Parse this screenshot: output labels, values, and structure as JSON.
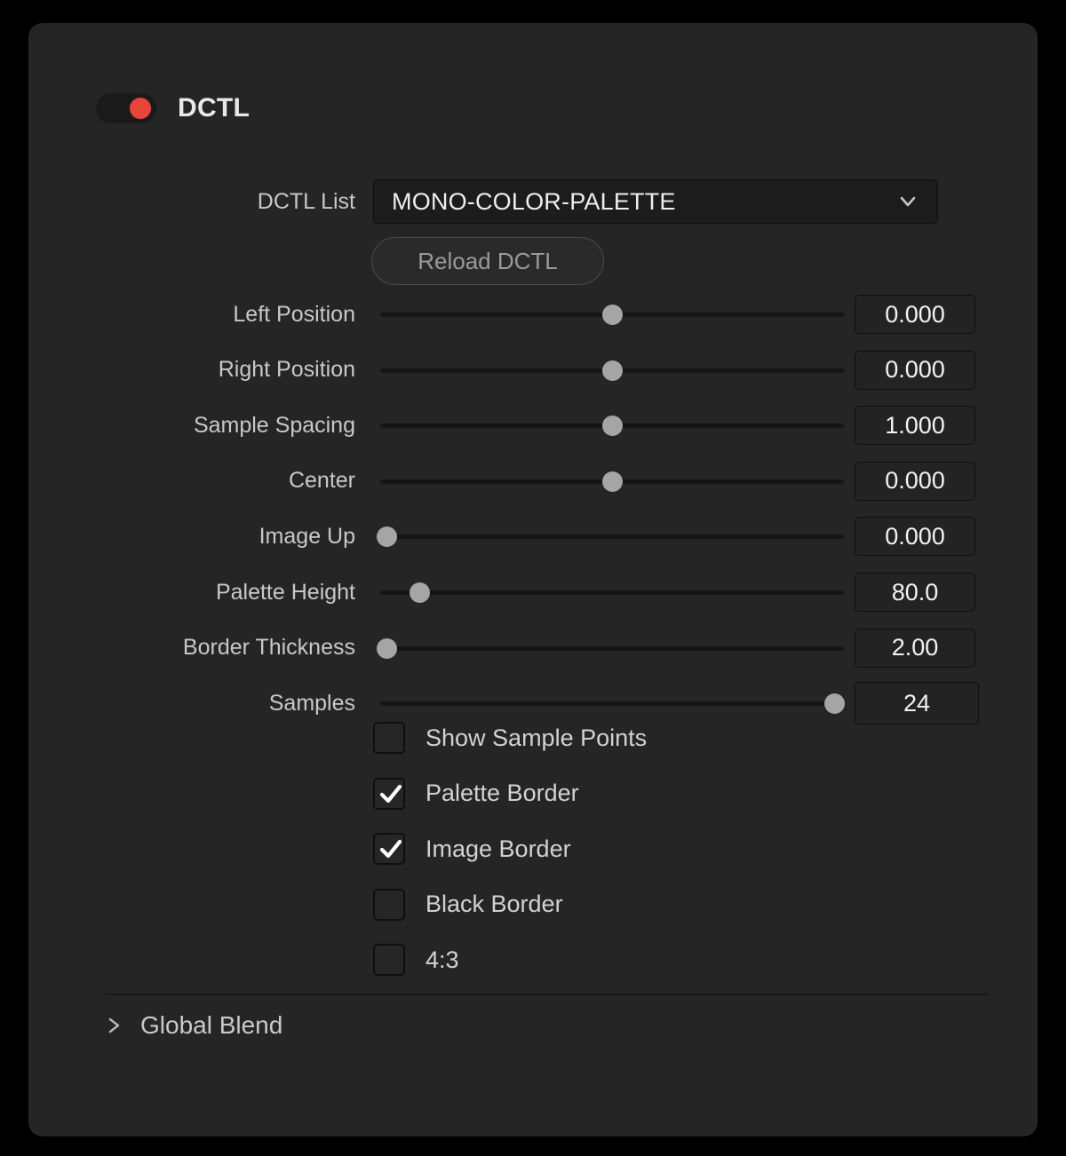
{
  "panel": {
    "header": {
      "title": "DCTL",
      "toggle_on": true,
      "toggle_color": "#e8443a"
    },
    "dctl_list": {
      "label": "DCTL List",
      "value": "MONO-COLOR-PALETTE",
      "chevron_icon": "chevron-down-icon"
    },
    "reload_button": {
      "label": "Reload DCTL"
    },
    "sliders": [
      {
        "label": "Left Position",
        "value": "0.000",
        "fraction": 0.5
      },
      {
        "label": "Right Position",
        "value": "0.000",
        "fraction": 0.5
      },
      {
        "label": "Sample Spacing",
        "value": "1.000",
        "fraction": 0.5
      },
      {
        "label": "Center",
        "value": "0.000",
        "fraction": 0.5
      },
      {
        "label": "Image Up",
        "value": "0.000",
        "fraction": 0.015
      },
      {
        "label": "Palette Height",
        "value": "80.0",
        "fraction": 0.085
      },
      {
        "label": "Border Thickness",
        "value": "2.00",
        "fraction": 0.015
      },
      {
        "label": "Samples",
        "value": "24",
        "fraction": 0.98
      }
    ],
    "checkboxes": [
      {
        "label": "Show Sample Points",
        "checked": false
      },
      {
        "label": "Palette Border",
        "checked": true
      },
      {
        "label": "Image Border",
        "checked": true
      },
      {
        "label": "Black Border",
        "checked": false
      },
      {
        "label": "4:3",
        "checked": false
      }
    ],
    "footer": {
      "global_blend_label": "Global Blend",
      "chevron_icon": "chevron-right-icon"
    }
  }
}
